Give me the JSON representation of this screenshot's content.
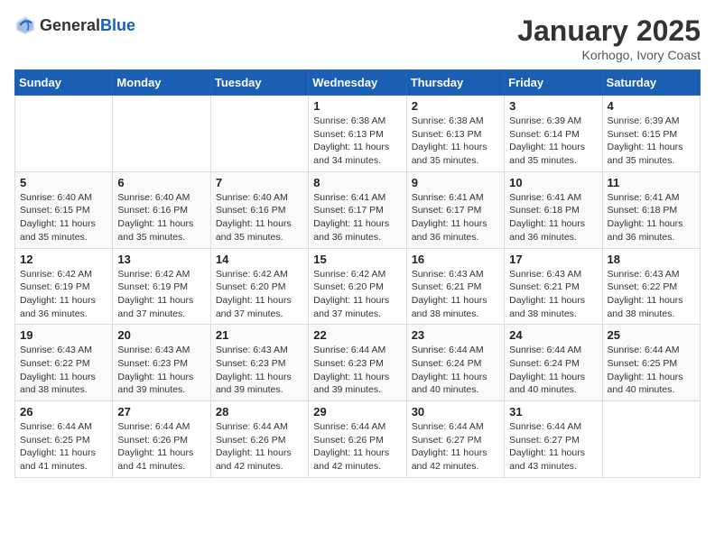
{
  "logo": {
    "general": "General",
    "blue": "Blue"
  },
  "title": "January 2025",
  "subtitle": "Korhogo, Ivory Coast",
  "weekdays": [
    "Sunday",
    "Monday",
    "Tuesday",
    "Wednesday",
    "Thursday",
    "Friday",
    "Saturday"
  ],
  "weeks": [
    [
      {
        "day": "",
        "info": ""
      },
      {
        "day": "",
        "info": ""
      },
      {
        "day": "",
        "info": ""
      },
      {
        "day": "1",
        "info": "Sunrise: 6:38 AM\nSunset: 6:13 PM\nDaylight: 11 hours and 34 minutes."
      },
      {
        "day": "2",
        "info": "Sunrise: 6:38 AM\nSunset: 6:13 PM\nDaylight: 11 hours and 35 minutes."
      },
      {
        "day": "3",
        "info": "Sunrise: 6:39 AM\nSunset: 6:14 PM\nDaylight: 11 hours and 35 minutes."
      },
      {
        "day": "4",
        "info": "Sunrise: 6:39 AM\nSunset: 6:15 PM\nDaylight: 11 hours and 35 minutes."
      }
    ],
    [
      {
        "day": "5",
        "info": "Sunrise: 6:40 AM\nSunset: 6:15 PM\nDaylight: 11 hours and 35 minutes."
      },
      {
        "day": "6",
        "info": "Sunrise: 6:40 AM\nSunset: 6:16 PM\nDaylight: 11 hours and 35 minutes."
      },
      {
        "day": "7",
        "info": "Sunrise: 6:40 AM\nSunset: 6:16 PM\nDaylight: 11 hours and 35 minutes."
      },
      {
        "day": "8",
        "info": "Sunrise: 6:41 AM\nSunset: 6:17 PM\nDaylight: 11 hours and 36 minutes."
      },
      {
        "day": "9",
        "info": "Sunrise: 6:41 AM\nSunset: 6:17 PM\nDaylight: 11 hours and 36 minutes."
      },
      {
        "day": "10",
        "info": "Sunrise: 6:41 AM\nSunset: 6:18 PM\nDaylight: 11 hours and 36 minutes."
      },
      {
        "day": "11",
        "info": "Sunrise: 6:41 AM\nSunset: 6:18 PM\nDaylight: 11 hours and 36 minutes."
      }
    ],
    [
      {
        "day": "12",
        "info": "Sunrise: 6:42 AM\nSunset: 6:19 PM\nDaylight: 11 hours and 36 minutes."
      },
      {
        "day": "13",
        "info": "Sunrise: 6:42 AM\nSunset: 6:19 PM\nDaylight: 11 hours and 37 minutes."
      },
      {
        "day": "14",
        "info": "Sunrise: 6:42 AM\nSunset: 6:20 PM\nDaylight: 11 hours and 37 minutes."
      },
      {
        "day": "15",
        "info": "Sunrise: 6:42 AM\nSunset: 6:20 PM\nDaylight: 11 hours and 37 minutes."
      },
      {
        "day": "16",
        "info": "Sunrise: 6:43 AM\nSunset: 6:21 PM\nDaylight: 11 hours and 38 minutes."
      },
      {
        "day": "17",
        "info": "Sunrise: 6:43 AM\nSunset: 6:21 PM\nDaylight: 11 hours and 38 minutes."
      },
      {
        "day": "18",
        "info": "Sunrise: 6:43 AM\nSunset: 6:22 PM\nDaylight: 11 hours and 38 minutes."
      }
    ],
    [
      {
        "day": "19",
        "info": "Sunrise: 6:43 AM\nSunset: 6:22 PM\nDaylight: 11 hours and 38 minutes."
      },
      {
        "day": "20",
        "info": "Sunrise: 6:43 AM\nSunset: 6:23 PM\nDaylight: 11 hours and 39 minutes."
      },
      {
        "day": "21",
        "info": "Sunrise: 6:43 AM\nSunset: 6:23 PM\nDaylight: 11 hours and 39 minutes."
      },
      {
        "day": "22",
        "info": "Sunrise: 6:44 AM\nSunset: 6:23 PM\nDaylight: 11 hours and 39 minutes."
      },
      {
        "day": "23",
        "info": "Sunrise: 6:44 AM\nSunset: 6:24 PM\nDaylight: 11 hours and 40 minutes."
      },
      {
        "day": "24",
        "info": "Sunrise: 6:44 AM\nSunset: 6:24 PM\nDaylight: 11 hours and 40 minutes."
      },
      {
        "day": "25",
        "info": "Sunrise: 6:44 AM\nSunset: 6:25 PM\nDaylight: 11 hours and 40 minutes."
      }
    ],
    [
      {
        "day": "26",
        "info": "Sunrise: 6:44 AM\nSunset: 6:25 PM\nDaylight: 11 hours and 41 minutes."
      },
      {
        "day": "27",
        "info": "Sunrise: 6:44 AM\nSunset: 6:26 PM\nDaylight: 11 hours and 41 minutes."
      },
      {
        "day": "28",
        "info": "Sunrise: 6:44 AM\nSunset: 6:26 PM\nDaylight: 11 hours and 42 minutes."
      },
      {
        "day": "29",
        "info": "Sunrise: 6:44 AM\nSunset: 6:26 PM\nDaylight: 11 hours and 42 minutes."
      },
      {
        "day": "30",
        "info": "Sunrise: 6:44 AM\nSunset: 6:27 PM\nDaylight: 11 hours and 42 minutes."
      },
      {
        "day": "31",
        "info": "Sunrise: 6:44 AM\nSunset: 6:27 PM\nDaylight: 11 hours and 43 minutes."
      },
      {
        "day": "",
        "info": ""
      }
    ]
  ]
}
